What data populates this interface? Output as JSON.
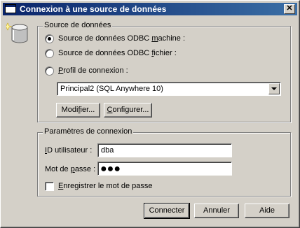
{
  "window": {
    "title": "Connexion à une source de données",
    "close_glyph": "✕"
  },
  "datasource_group": {
    "legend": "Source de données",
    "options": [
      {
        "prefix": "Source de données ODBC ",
        "accel": "m",
        "suffix": "achine :",
        "checked": true
      },
      {
        "prefix": "Source de données ODBC ",
        "accel": "f",
        "suffix": "ichier :",
        "checked": false
      },
      {
        "prefix": "",
        "accel": "P",
        "suffix": "rofil de connexion :",
        "checked": false
      }
    ],
    "selected_profile": "Principal2 (SQL Anywhere 10)",
    "modify_button": {
      "prefix": "Modi",
      "accel": "f",
      "suffix": "ier..."
    },
    "configure_button": {
      "prefix": "",
      "accel": "C",
      "suffix": "onfigurer..."
    }
  },
  "connection_group": {
    "legend": "Paramètres de connexion",
    "user_label": {
      "prefix": "",
      "accel": "I",
      "suffix": "D utilisateur :"
    },
    "user_value": "dba",
    "password_label": {
      "prefix": "Mot de ",
      "accel": "p",
      "suffix": "asse :"
    },
    "password_mask": "●●●",
    "save_password": {
      "prefix": "",
      "accel": "E",
      "suffix": "nregistrer le mot de passe",
      "checked": false
    }
  },
  "buttons": {
    "connect": "Connecter",
    "cancel": "Annuler",
    "help": "Aide"
  },
  "icons": {
    "title": "window-icon",
    "database": "database-icon"
  }
}
